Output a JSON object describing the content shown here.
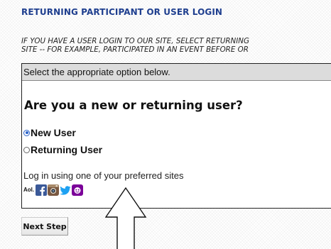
{
  "section": {
    "heading": "RETURNING PARTICIPANT OR USER LOGIN",
    "info_line1": "IF YOU HAVE A USER LOGIN TO OUR SITE, SELECT RETURNING",
    "info_line2": "SITE -- FOR EXAMPLE, PARTICIPATED IN AN EVENT BEFORE OR"
  },
  "panel": {
    "header": "Select the appropriate option below.",
    "question": "Are you a new or returning user?",
    "options": [
      {
        "label": "New User",
        "selected": true
      },
      {
        "label": "Returning User",
        "selected": false
      }
    ],
    "social_prompt": "Log in using one of your preferred sites",
    "social_sites": [
      {
        "icon": "aol-icon",
        "label": "Aol."
      },
      {
        "icon": "facebook-icon",
        "color": "#3b5998"
      },
      {
        "icon": "instagram-icon",
        "color": "#7a5840"
      },
      {
        "icon": "twitter-icon",
        "color": "#1da1f2"
      },
      {
        "icon": "yahoo-icon",
        "color": "#7b0099"
      }
    ]
  },
  "actions": {
    "next_label": "Next Step"
  }
}
